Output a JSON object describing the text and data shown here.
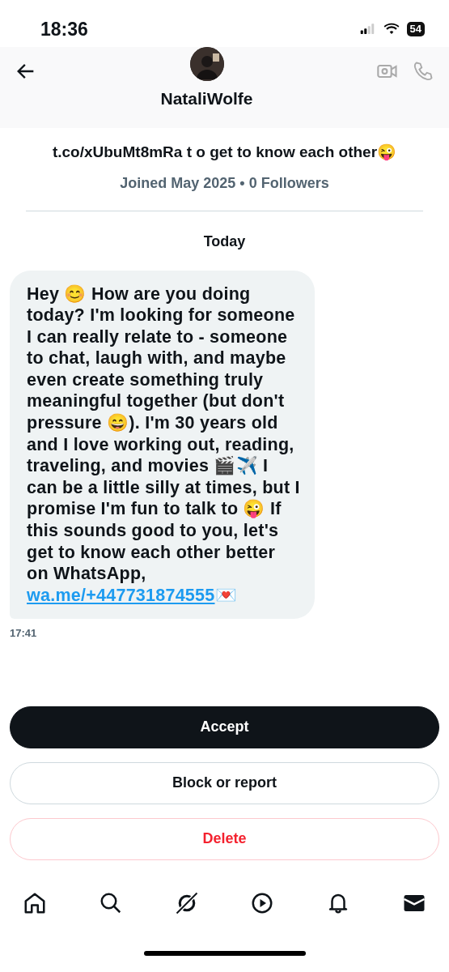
{
  "status_bar": {
    "time": "18:36",
    "battery": "54"
  },
  "header": {
    "name": "NataliWolfe"
  },
  "profile": {
    "bio": "t.co/xUbuMt8mRa t o get to know each other😜",
    "joined": "Joined May 2025 • 0 Followers"
  },
  "day_label": "Today",
  "messages": [
    {
      "text": "Hey 😊 How are you doing today? I'm looking for someone I can really relate to - someone to chat, laugh with, and maybe even create something truly meaningful together (but don't pressure 😄). I'm 30 years old and I love working out, reading, traveling, and movies 🎬✈️ I can be a little silly at times, but I promise I'm fun to talk to 😜 If this sounds good to you, let's get to know each other better on WhatsApp, ",
      "link": "wa.me/+447731874555",
      "after": "💌",
      "time": "17:41"
    }
  ],
  "actions": [
    {
      "label": "Accept",
      "kind": "primary"
    },
    {
      "label": "Block or report",
      "kind": "outline"
    },
    {
      "label": "Delete",
      "kind": "danger"
    }
  ],
  "nav": [
    {
      "kind": "home",
      "selected": false
    },
    {
      "kind": "search",
      "selected": false
    },
    {
      "kind": "grok",
      "selected": false
    },
    {
      "kind": "video",
      "selected": false
    },
    {
      "kind": "notifications",
      "selected": false
    },
    {
      "kind": "messages",
      "selected": true
    }
  ]
}
